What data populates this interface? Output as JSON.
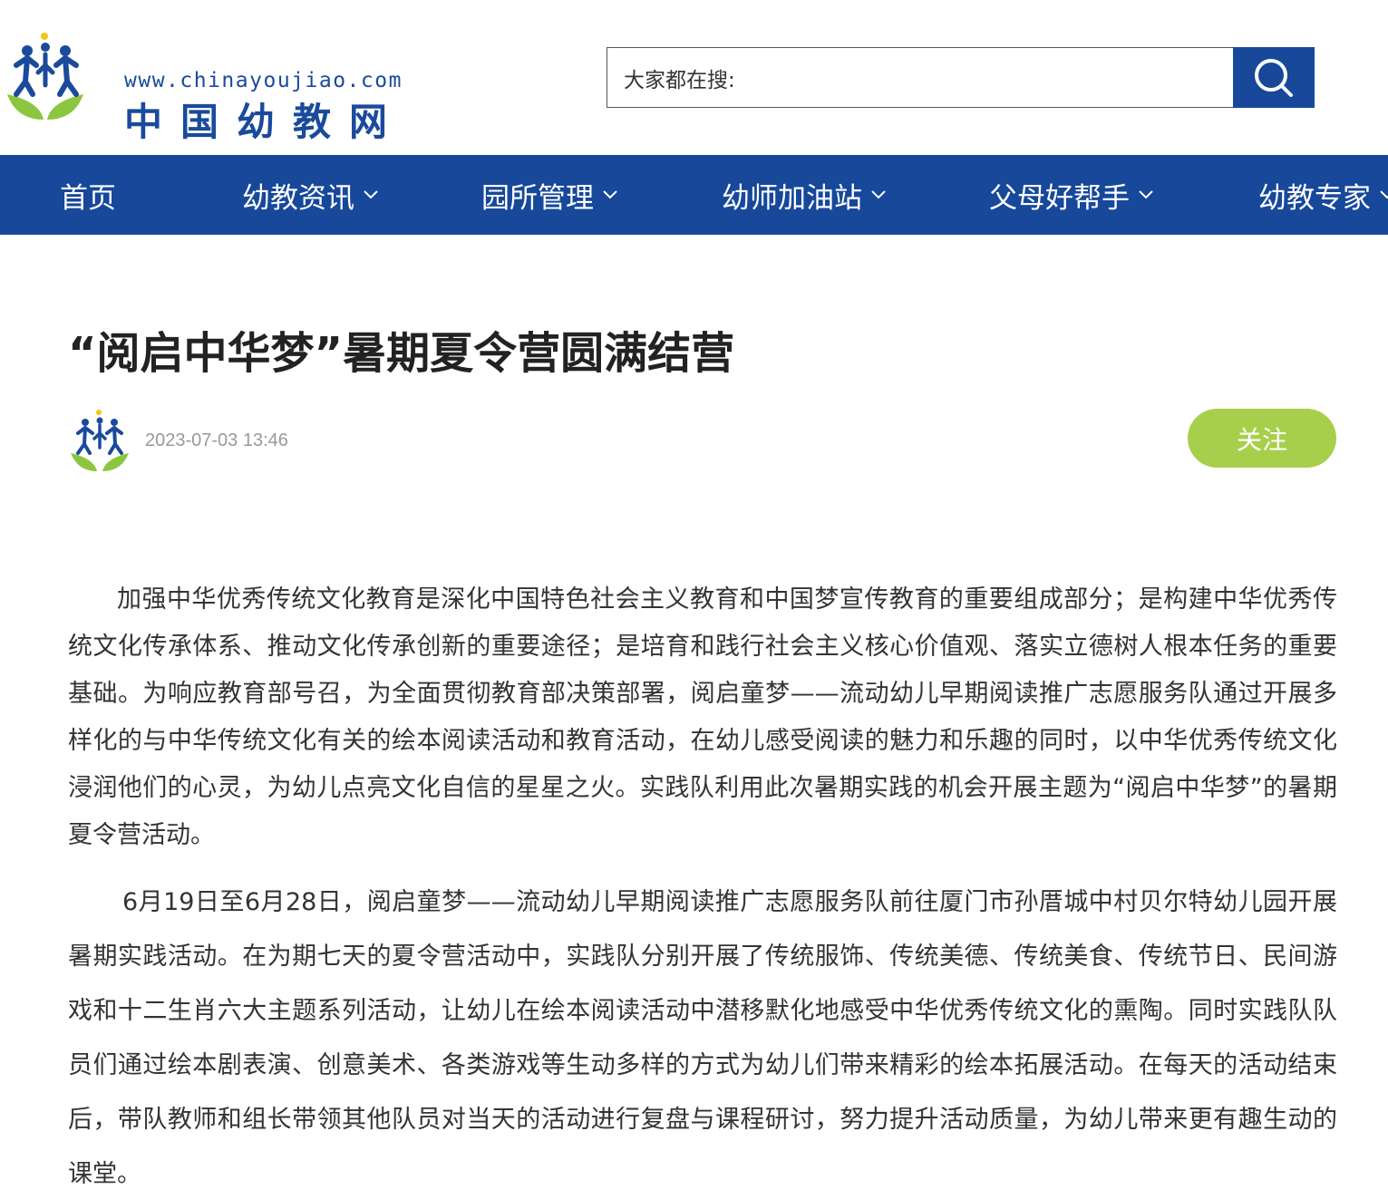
{
  "header": {
    "logo_url_text": "www.chinayoujiao.com",
    "logo_name": "中国幼教网",
    "search_placeholder": "大家都在搜:",
    "search_icon": "search-icon"
  },
  "nav": {
    "items": [
      {
        "label": "首页",
        "has_dropdown": false
      },
      {
        "label": "幼教资讯",
        "has_dropdown": true
      },
      {
        "label": "园所管理",
        "has_dropdown": true
      },
      {
        "label": "幼师加油站",
        "has_dropdown": true
      },
      {
        "label": "父母好帮手",
        "has_dropdown": true
      },
      {
        "label": "幼教专家",
        "has_dropdown": true
      }
    ]
  },
  "article": {
    "title": "“阅启中华梦”暑期夏令营圆满结营",
    "date": "2023-07-03 13:46",
    "follow_label": "关注",
    "paragraphs": [
      "加强中华优秀传统文化教育是深化中国特色社会主义教育和中国梦宣传教育的重要组成部分；是构建中华优秀传统文化传承体系、推动文化传承创新的重要途径；是培育和践行社会主义核心价值观、落实立德树人根本任务的重要基础。为响应教育部号召，为全面贯彻教育部决策部署，阅启童梦——流动幼儿早期阅读推广志愿服务队通过开展多样化的与中华传统文化有关的绘本阅读活动和教育活动，在幼儿感受阅读的魅力和乐趣的同时，以中华优秀传统文化浸润他们的心灵，为幼儿点亮文化自信的星星之火。实践队利用此次暑期实践的机会开展主题为“阅启中华梦”的暑期夏令营活动。",
      "6月19日至6月28日，阅启童梦——流动幼儿早期阅读推广志愿服务队前往厦门市孙厝城中村贝尔特幼儿园开展暑期实践活动。在为期七天的夏令营活动中，实践队分别开展了传统服饰、传统美德、传统美食、传统节日、民间游戏和十二生肖六大主题系列活动，让幼儿在绘本阅读活动中潜移默化地感受中华优秀传统文化的熏陶。同时实践队队员们通过绘本剧表演、创意美术、各类游戏等生动多样的方式为幼儿们带来精彩的绘本拓展活动。在每天的活动结束后，带队教师和组长带领其他队员对当天的活动进行复盘与课程研讨，努力提升活动质量，为幼儿带来更有趣生动的课堂。"
    ]
  },
  "colors": {
    "brand_blue": "#17489a",
    "follow_green": "#a8cf4b",
    "logo_leaf_green": "#8cc63f",
    "logo_sun_yellow": "#f5c518"
  }
}
